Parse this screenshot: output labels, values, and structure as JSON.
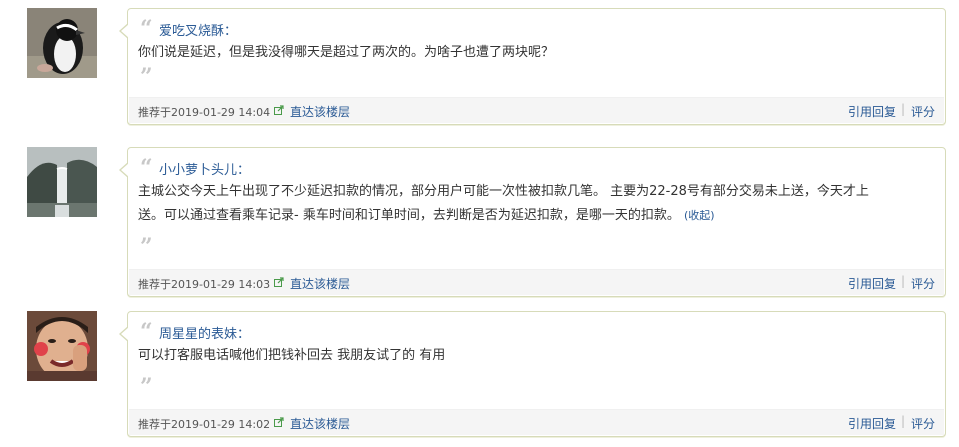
{
  "posts": [
    {
      "author": "爱吃叉烧酥：",
      "lines": [
        "你们说是延迟，但是我没得哪天是超过了两次的。为啥子也遭了两块呢？"
      ],
      "timestamp": "推荐于2019-01-29 14:04",
      "jump_label": "直达该楼层",
      "reply_label": "引用回复",
      "separator": "|",
      "rate_label": "评分",
      "avatar_icon": "penguin"
    },
    {
      "author": "小小萝卜头儿：",
      "lines": [
        "主城公交今天上午出现了不少延迟扣款的情况，部分用户可能一次性被扣款几笔。 主要为22-28号有部分交易未上送，今天才上",
        "送。可以通过查看乘车记录- 乘车时间和订单时间，去判断是否为延迟扣款，是哪一天的扣款。"
      ],
      "collapse_label": "(收起)",
      "timestamp": "推荐于2019-01-29 14:03",
      "jump_label": "直达该楼层",
      "reply_label": "引用回复",
      "separator": "|",
      "rate_label": "评分",
      "avatar_icon": "waterfall"
    },
    {
      "author": "周星星的表妹：",
      "lines": [
        "可以打客服电话喊他们把钱补回去 我朋友试了的 有用"
      ],
      "timestamp": "推荐于2019-01-29 14:02",
      "jump_label": "直达该楼层",
      "reply_label": "引用回复",
      "separator": "|",
      "rate_label": "评分",
      "avatar_icon": "funny-face"
    }
  ],
  "colors": {
    "link": "#2a5a95",
    "card_border": "#d7dbb9",
    "footer_bg": "#f5f5f5"
  }
}
